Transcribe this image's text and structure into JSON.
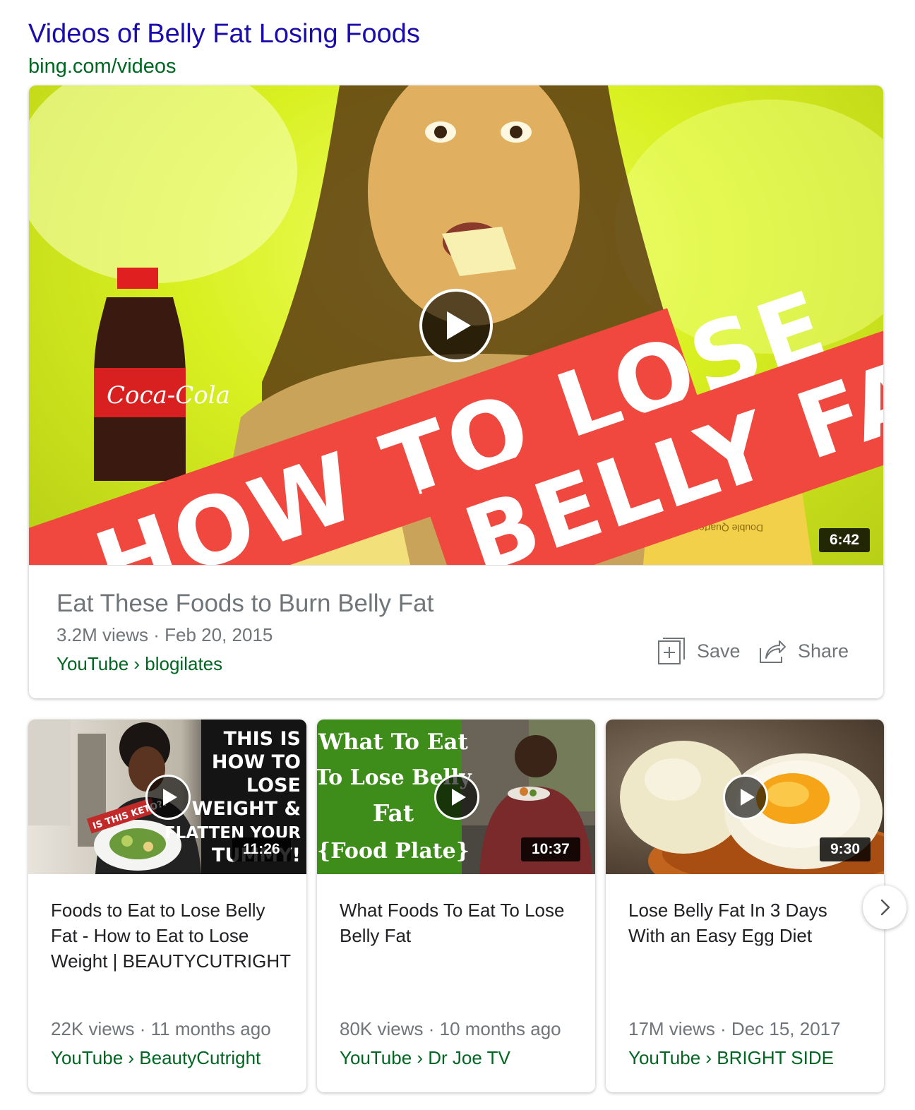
{
  "header": {
    "title": "Videos of Belly Fat Losing Foods",
    "url": "bing.com/videos"
  },
  "featured": {
    "title": "Eat These Foods to Burn Belly Fat",
    "meta": "3.2M views · Feb 20, 2015",
    "source": "YouTube › blogilates",
    "duration": "6:42",
    "thumb_text": {
      "banner1": "HOW TO LOSE",
      "banner2": "BELLY FAT",
      "bottle": "Coca-Cola",
      "box": "Double Quarter Pounder"
    },
    "actions": {
      "save": "Save",
      "share": "Share"
    }
  },
  "cards": [
    {
      "title": "Foods to Eat to Lose Belly Fat - How to Eat to Lose Weight | BEAUTYCUTRIGHT",
      "meta": "22K views · 11 months ago",
      "source": "YouTube › BeautyCutright",
      "duration": "11:26",
      "thumb_lines": [
        "THIS IS",
        "HOW TO",
        "LOSE",
        "WEIGHT &",
        "FLATTEN YOUR",
        "TUMMY!"
      ],
      "sticker": "IS THIS KETO?!"
    },
    {
      "title": "What Foods To Eat To Lose Belly Fat",
      "meta": "80K views · 10 months ago",
      "source": "YouTube › Dr Joe TV",
      "duration": "10:37",
      "thumb_lines": [
        "What To Eat",
        "To Lose Belly",
        "Fat",
        "{Food Plate}"
      ]
    },
    {
      "title": "Lose Belly Fat In 3 Days With an Easy Egg Diet",
      "meta": "17M views · Dec 15, 2017",
      "source": "YouTube › BRIGHT SIDE",
      "duration": "9:30"
    }
  ],
  "colors": {
    "link": "#1a0dab",
    "url_green": "#006621",
    "meta_gray": "#70757a",
    "banner_red": "#f0483e"
  }
}
